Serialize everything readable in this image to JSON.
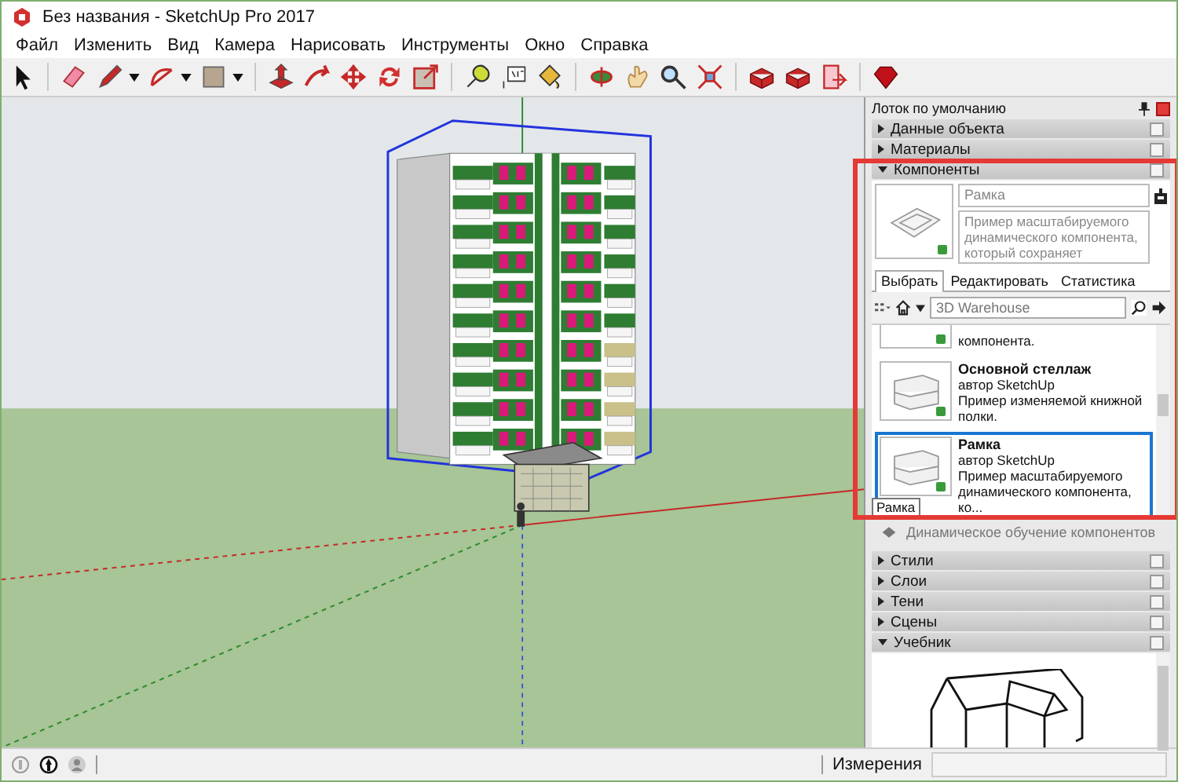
{
  "window": {
    "title": "Без названия - SketchUp Pro 2017"
  },
  "menu": [
    "Файл",
    "Изменить",
    "Вид",
    "Камера",
    "Нарисовать",
    "Инструменты",
    "Окно",
    "Справка"
  ],
  "tray": {
    "title": "Лоток по умолчанию",
    "sections_top": [
      {
        "label": "Данные объекта",
        "expanded": false
      },
      {
        "label": "Материалы",
        "expanded": false
      },
      {
        "label": "Компоненты",
        "expanded": true
      }
    ],
    "components": {
      "name_field": "Рамка",
      "description": "Пример масштабируемого динамического компонента, который сохраняет",
      "tabs": [
        {
          "label": "Выбрать",
          "selected": true
        },
        {
          "label": "Редактировать",
          "selected": false
        },
        {
          "label": "Статистика",
          "selected": false
        }
      ],
      "search": {
        "placeholder": "3D Warehouse"
      },
      "items": [
        {
          "kind": "partial",
          "description": "компонента.",
          "selected": false
        },
        {
          "kind": "full",
          "title": "Основной стеллаж",
          "author": "автор SketchUp",
          "description": "Пример изменяемой книжной полки.",
          "selected": false
        },
        {
          "kind": "full",
          "title": "Рамка",
          "author": "автор SketchUp",
          "description": "Пример масштабируемого динамического компонента, ко...",
          "selected": true
        }
      ],
      "tooltip": "Рамка",
      "footer": "Динамическое обучение компонентов"
    },
    "sections_bottom": [
      {
        "label": "Стили",
        "expanded": false
      },
      {
        "label": "Слои",
        "expanded": false
      },
      {
        "label": "Тени",
        "expanded": false
      },
      {
        "label": "Сцены",
        "expanded": false
      },
      {
        "label": "Учебник",
        "expanded": true
      }
    ]
  },
  "status_bar": {
    "measurements_label": "Измерения"
  }
}
